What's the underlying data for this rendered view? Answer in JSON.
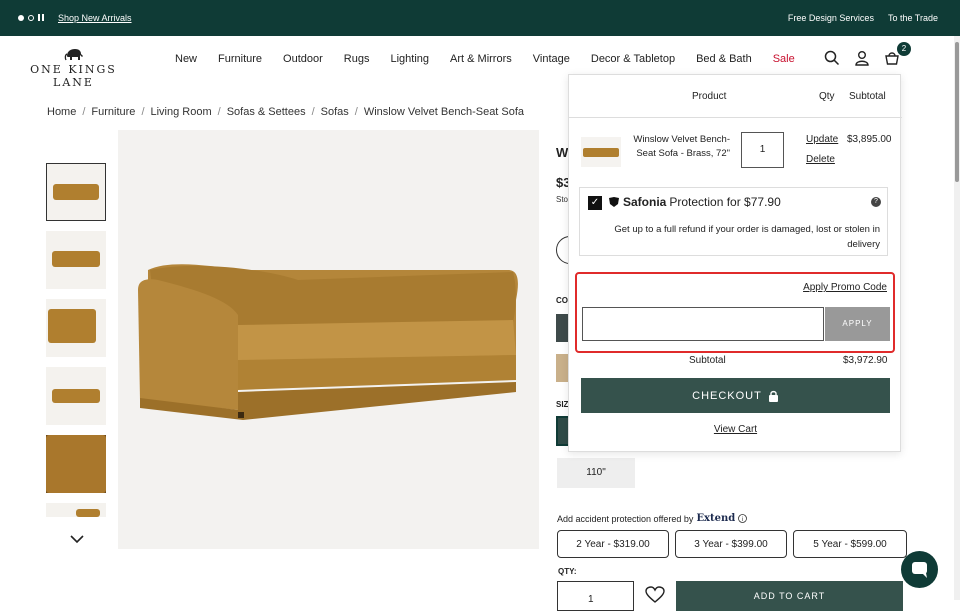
{
  "topbar": {
    "promo_link": "Shop New Arrivals",
    "links": [
      "Free Design Services",
      "To the Trade"
    ]
  },
  "brand": {
    "logo_text": "ONE KINGS LANE"
  },
  "nav": {
    "items": [
      "New",
      "Furniture",
      "Outdoor",
      "Rugs",
      "Lighting",
      "Art & Mirrors",
      "Vintage",
      "Decor & Tabletop",
      "Bed & Bath",
      "Sale"
    ]
  },
  "cart_badge": "2",
  "breadcrumb": [
    "Home",
    "Furniture",
    "Living Room",
    "Sofas & Settees",
    "Sofas",
    "Winslow Velvet Bench-Seat Sofa"
  ],
  "product": {
    "title_partial": "W",
    "price_partial": "$3",
    "stock_partial": "Sto",
    "color_label_partial": "CO",
    "size_label_partial": "SIZ",
    "size_option": "110\"",
    "protection_text": "Add accident protection offered by",
    "protection_brand": "Extend",
    "plans": [
      "2 Year - $319.00",
      "3 Year - $399.00",
      "5 Year - $599.00"
    ],
    "qty_label": "QTY:",
    "qty_value": "1",
    "add_to_cart": "ADD TO CART"
  },
  "cart": {
    "headers": {
      "product": "Product",
      "qty": "Qty",
      "subtotal": "Subtotal"
    },
    "item": {
      "name": "Winslow Velvet Bench-Seat Sofa - Brass, 72\"",
      "qty": "1",
      "update": "Update",
      "delete": "Delete",
      "price": "$3,895.00"
    },
    "protection": {
      "brand": "Safonia",
      "label": "Protection for $77.90",
      "help": "?",
      "description": "Get up to a full refund if your order is damaged, lost or stolen in delivery"
    },
    "promo": {
      "link": "Apply Promo Code",
      "input_value": "",
      "apply_label": "APPLY"
    },
    "subtotal_label": "Subtotal",
    "subtotal_value": "$3,972.90",
    "checkout_label": "CHECKOUT",
    "view_cart_label": "View Cart"
  },
  "colors": {
    "brand_dark": "#0f3b36",
    "button_green": "#35524c",
    "sale_red": "#c8102e",
    "highlight_red": "#e02b2b",
    "sofa_ochre": "#b07f2f"
  },
  "icons": [
    "carousel-dots",
    "pause-icon",
    "elephant-logo",
    "search-icon",
    "user-icon",
    "cart-icon",
    "chevron-down-icon",
    "lock-icon",
    "check-icon",
    "help-icon",
    "heart-icon",
    "chat-icon",
    "safonia-shield-icon"
  ]
}
